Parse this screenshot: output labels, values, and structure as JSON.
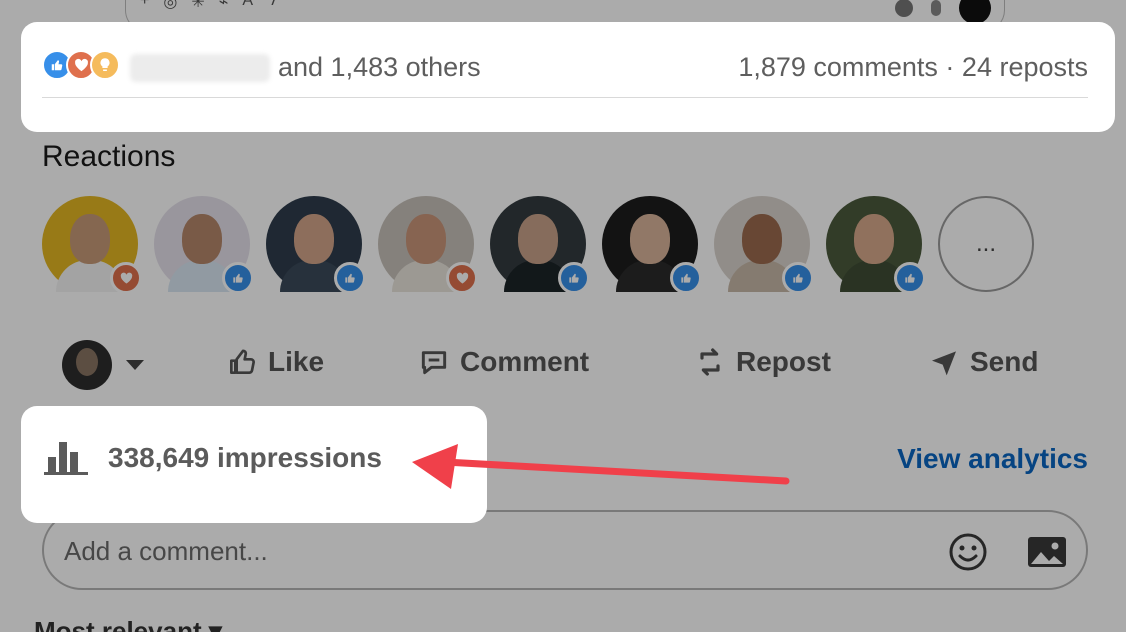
{
  "social": {
    "others_text": "and 1,483 others",
    "engagement_text": "1,879 comments · 24 reposts",
    "reaction_icons": [
      "like-icon",
      "love-icon",
      "insightful-icon"
    ]
  },
  "reactions": {
    "title": "Reactions",
    "avatars": [
      {
        "bg": "#e3b623",
        "skin": "#c79a78",
        "shirt": "#f3f3f3",
        "badge": "love"
      },
      {
        "bg": "#e4e0ea",
        "skin": "#b5876a",
        "shirt": "#d8e6f2",
        "badge": "like"
      },
      {
        "bg": "#2f3d4c",
        "skin": "#d2a58a",
        "shirt": "#3b4a5a",
        "badge": "like"
      },
      {
        "bg": "#c7c1b9",
        "skin": "#c9957a",
        "shirt": "#e9e4dc",
        "badge": "love"
      },
      {
        "bg": "#333b3f",
        "skin": "#c8a28a",
        "shirt": "#1c2428",
        "badge": "like"
      },
      {
        "bg": "#1d1d1d",
        "skin": "#d8b49a",
        "shirt": "#2a2a2a",
        "badge": "like"
      },
      {
        "bg": "#d9d3cc",
        "skin": "#9b6a4e",
        "shirt": "#c7b8a8",
        "badge": "like"
      },
      {
        "bg": "#4b5a3d",
        "skin": "#d7a98b",
        "shirt": "#3f4c35",
        "badge": "like"
      }
    ],
    "more_label": "..."
  },
  "actions": {
    "like": "Like",
    "comment": "Comment",
    "repost": "Repost",
    "send": "Send"
  },
  "impressions": {
    "text": "338,649 impressions",
    "analytics_link": "View analytics"
  },
  "comment": {
    "placeholder": "Add a comment..."
  },
  "sort": {
    "label": "Most relevant ▾"
  },
  "colors": {
    "accent_link": "#0a66c2",
    "annotation_arrow": "#f0404a",
    "like_blue": "#378fe9",
    "love_red": "#df704d"
  }
}
